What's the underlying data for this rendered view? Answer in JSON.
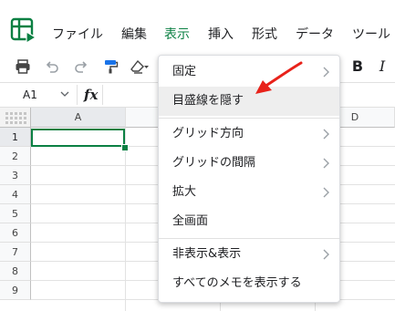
{
  "menubar": {
    "items": [
      {
        "label": "ファイル"
      },
      {
        "label": "編集"
      },
      {
        "label": "表示",
        "active": true
      },
      {
        "label": "挿入"
      },
      {
        "label": "形式"
      },
      {
        "label": "データ"
      },
      {
        "label": "ツール"
      }
    ]
  },
  "toolbar": {
    "icons": [
      "print-icon",
      "undo-icon",
      "redo-icon",
      "paint-format-icon",
      "clear-format-icon"
    ],
    "bold_label": "B",
    "italic_label": "I"
  },
  "formula_bar": {
    "cell_ref": "A1",
    "fx_label": "fx"
  },
  "grid": {
    "columns": [
      "A",
      "B",
      "C",
      "D"
    ],
    "rows": [
      "1",
      "2",
      "3",
      "4",
      "5",
      "6",
      "7",
      "8",
      "9"
    ],
    "selected_cell": "A1"
  },
  "view_menu": {
    "items": [
      {
        "label": "固定",
        "has_submenu": true
      },
      {
        "label": "目盛線を隠す",
        "has_submenu": false,
        "hovered": true
      },
      {
        "label": "グリッド方向",
        "has_submenu": true
      },
      {
        "label": "グリッドの間隔",
        "has_submenu": true
      },
      {
        "label": "拡大",
        "has_submenu": true
      },
      {
        "label": "全画面",
        "has_submenu": false
      },
      {
        "label": "非表示&表示",
        "has_submenu": true
      },
      {
        "label": "すべてのメモを表示する",
        "has_submenu": false
      }
    ]
  },
  "colors": {
    "accent": "#0b8043",
    "annotation_arrow": "#e8221a",
    "hover_bg": "#eeeeee"
  }
}
